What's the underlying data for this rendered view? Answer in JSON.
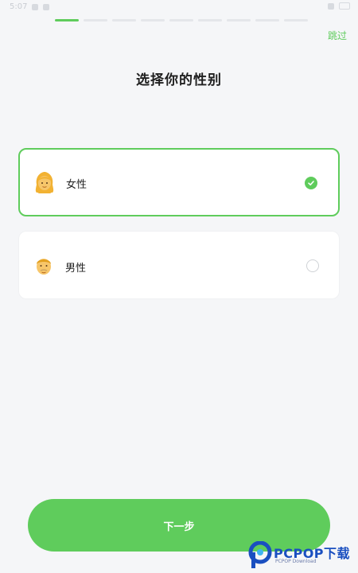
{
  "status_bar": {
    "time": "5:07"
  },
  "progress": {
    "total": 9,
    "current": 1
  },
  "header": {
    "skip_label": "跳过"
  },
  "page": {
    "title": "选择你的性别"
  },
  "options": [
    {
      "label": "女性",
      "emoji": "woman-face-icon",
      "selected": true
    },
    {
      "label": "男性",
      "emoji": "man-face-icon",
      "selected": false
    }
  ],
  "footer": {
    "next_label": "下一步"
  },
  "watermark": {
    "brand": "PCPOP下载",
    "sub": "PCPOP Download"
  },
  "colors": {
    "accent": "#5fcc5c",
    "background": "#f5f6f8",
    "card": "#ffffff"
  }
}
